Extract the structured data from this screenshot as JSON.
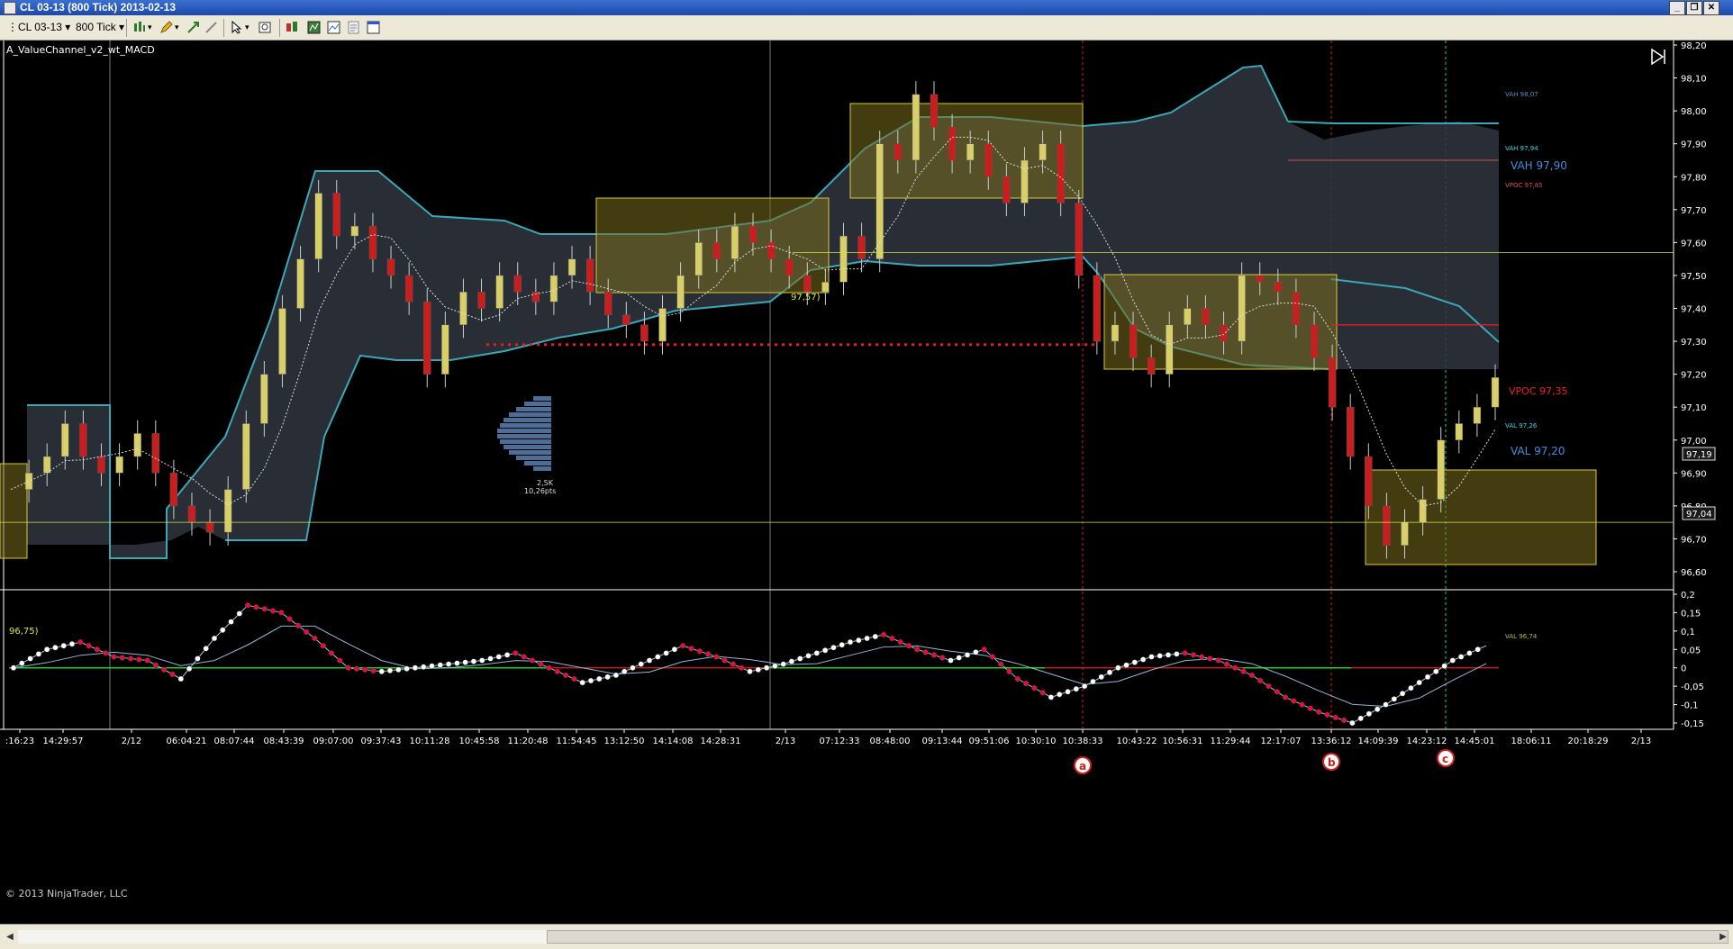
{
  "window": {
    "title": "CL 03-13 (800 Tick)  2013-02-13",
    "buttons": [
      "minimize",
      "restore",
      "close"
    ]
  },
  "toolbar": {
    "instrument": "CL 03-13",
    "interval": "800 Tick",
    "icons": [
      "chart-style-icon",
      "draw-pencil-icon",
      "zoom-in-icon",
      "zoom-out-icon",
      "cursor-icon",
      "properties-icon",
      "indicators-icon",
      "strategies-icon",
      "data-box-icon",
      "template-icon",
      "settings-icon"
    ]
  },
  "chart": {
    "indicator_label": "A_ValueChannel_v2_wt_MACD",
    "copyright": "© 2013 NinjaTrader, LLC",
    "colors": {
      "background": "#000000",
      "up_candle": "#d8cf6a",
      "down_candle": "#c81e1e",
      "channel_fill": "#2f3540",
      "channel_line": "#3aa8b8",
      "value_box": "#7a6d1e",
      "poc_line": "#c8e84a",
      "macd_zero": "#22cc22",
      "macd_dot_up": "#ffffff",
      "macd_dot_down": "#e0103a"
    },
    "price_axis": [
      "98,20",
      "98,10",
      "98,00",
      "97,90",
      "97,80",
      "97,70",
      "97,60",
      "97,50",
      "97,40",
      "97,30",
      "97,20",
      "97,10",
      "97,00",
      "96,90",
      "96,80",
      "96,70",
      "96,60"
    ],
    "macd_axis": [
      "0,2",
      "0,15",
      "0,1",
      "0,05",
      "0",
      "-0,05",
      "-0,1",
      "-0,15"
    ],
    "time_axis": [
      ":16:23",
      "14:29:57",
      "2/12",
      "06:04:21",
      "08:07:44",
      "08:43:39",
      "09:07:00",
      "09:37:43",
      "10:11:28",
      "10:45:58",
      "11:20:48",
      "11:54:45",
      "13:12:50",
      "14:14:08",
      "14:28:31",
      "2/13",
      "07:12:33",
      "08:48:00",
      "09:13:44",
      "09:51:06",
      "10:30:10",
      "10:38:33",
      "10:43:22",
      "10:56:31",
      "11:29:44",
      "12:17:07",
      "13:36:12",
      "14:09:39",
      "14:23:12",
      "14:45:01",
      "18:06:11",
      "20:18:29",
      "2/13"
    ],
    "level_labels": {
      "vah_top": "VAH 98,07",
      "vah_2": "VAH 97,94",
      "vah_big": "VAH 97,90",
      "vpoc": "VPOC 97,85",
      "vpoc_big": "VPOC 97,35",
      "val_1": "VAL 97,26",
      "val_big": "VAL 97,20",
      "val_low": "VAL 96,74"
    },
    "price_tags": [
      "97,19",
      "97,04"
    ],
    "poc_labels": [
      "97,57)",
      "96,75)"
    ],
    "profile_label_1": "2,5K",
    "profile_label_2": "10,26pts",
    "markers": [
      "a",
      "b",
      "c"
    ]
  },
  "chart_data": {
    "type": "candlestick",
    "title": "",
    "ylim": [
      96.55,
      98.2
    ],
    "series": [
      {
        "name": "",
        "values": [
          96.85,
          96.9,
          96.95,
          97.05,
          96.95,
          96.9,
          96.95,
          97.02,
          96.9,
          96.8,
          96.75,
          96.72,
          96.85,
          97.05,
          97.2,
          97.4,
          97.55,
          97.75,
          97.62,
          97.65,
          97.55,
          97.5,
          97.42,
          97.2,
          97.35,
          97.45,
          97.4,
          97.5,
          97.45,
          97.42,
          97.5,
          97.55,
          97.45,
          97.38,
          97.35,
          97.3,
          97.4,
          97.5,
          97.6,
          97.55,
          97.65,
          97.6,
          97.55,
          97.5,
          97.45,
          97.48,
          97.62,
          97.55,
          97.9,
          97.85,
          98.05,
          97.95,
          97.85,
          97.9,
          97.8,
          97.72,
          97.85,
          97.9,
          97.72,
          97.5,
          97.3,
          97.35,
          97.25,
          97.2,
          97.35,
          97.4,
          97.35,
          97.3,
          97.5,
          97.48,
          97.45,
          97.35,
          97.25,
          97.1,
          96.95,
          96.8,
          96.68,
          96.75,
          96.82,
          97.0,
          97.05,
          97.1,
          97.19
        ]
      }
    ],
    "macd": [
      0.0,
      0.05,
      0.07,
      0.03,
      0.02,
      -0.03,
      0.08,
      0.17,
      0.15,
      0.08,
      0.0,
      -0.01,
      0.0,
      0.01,
      0.02,
      0.04,
      0.0,
      -0.04,
      -0.02,
      0.02,
      0.06,
      0.03,
      -0.01,
      0.01,
      0.04,
      0.07,
      0.09,
      0.05,
      0.02,
      0.05,
      -0.03,
      -0.08,
      -0.05,
      0.0,
      0.03,
      0.04,
      0.02,
      -0.02,
      -0.08,
      -0.12,
      -0.15,
      -0.1,
      -0.04,
      0.02,
      0.06
    ]
  }
}
